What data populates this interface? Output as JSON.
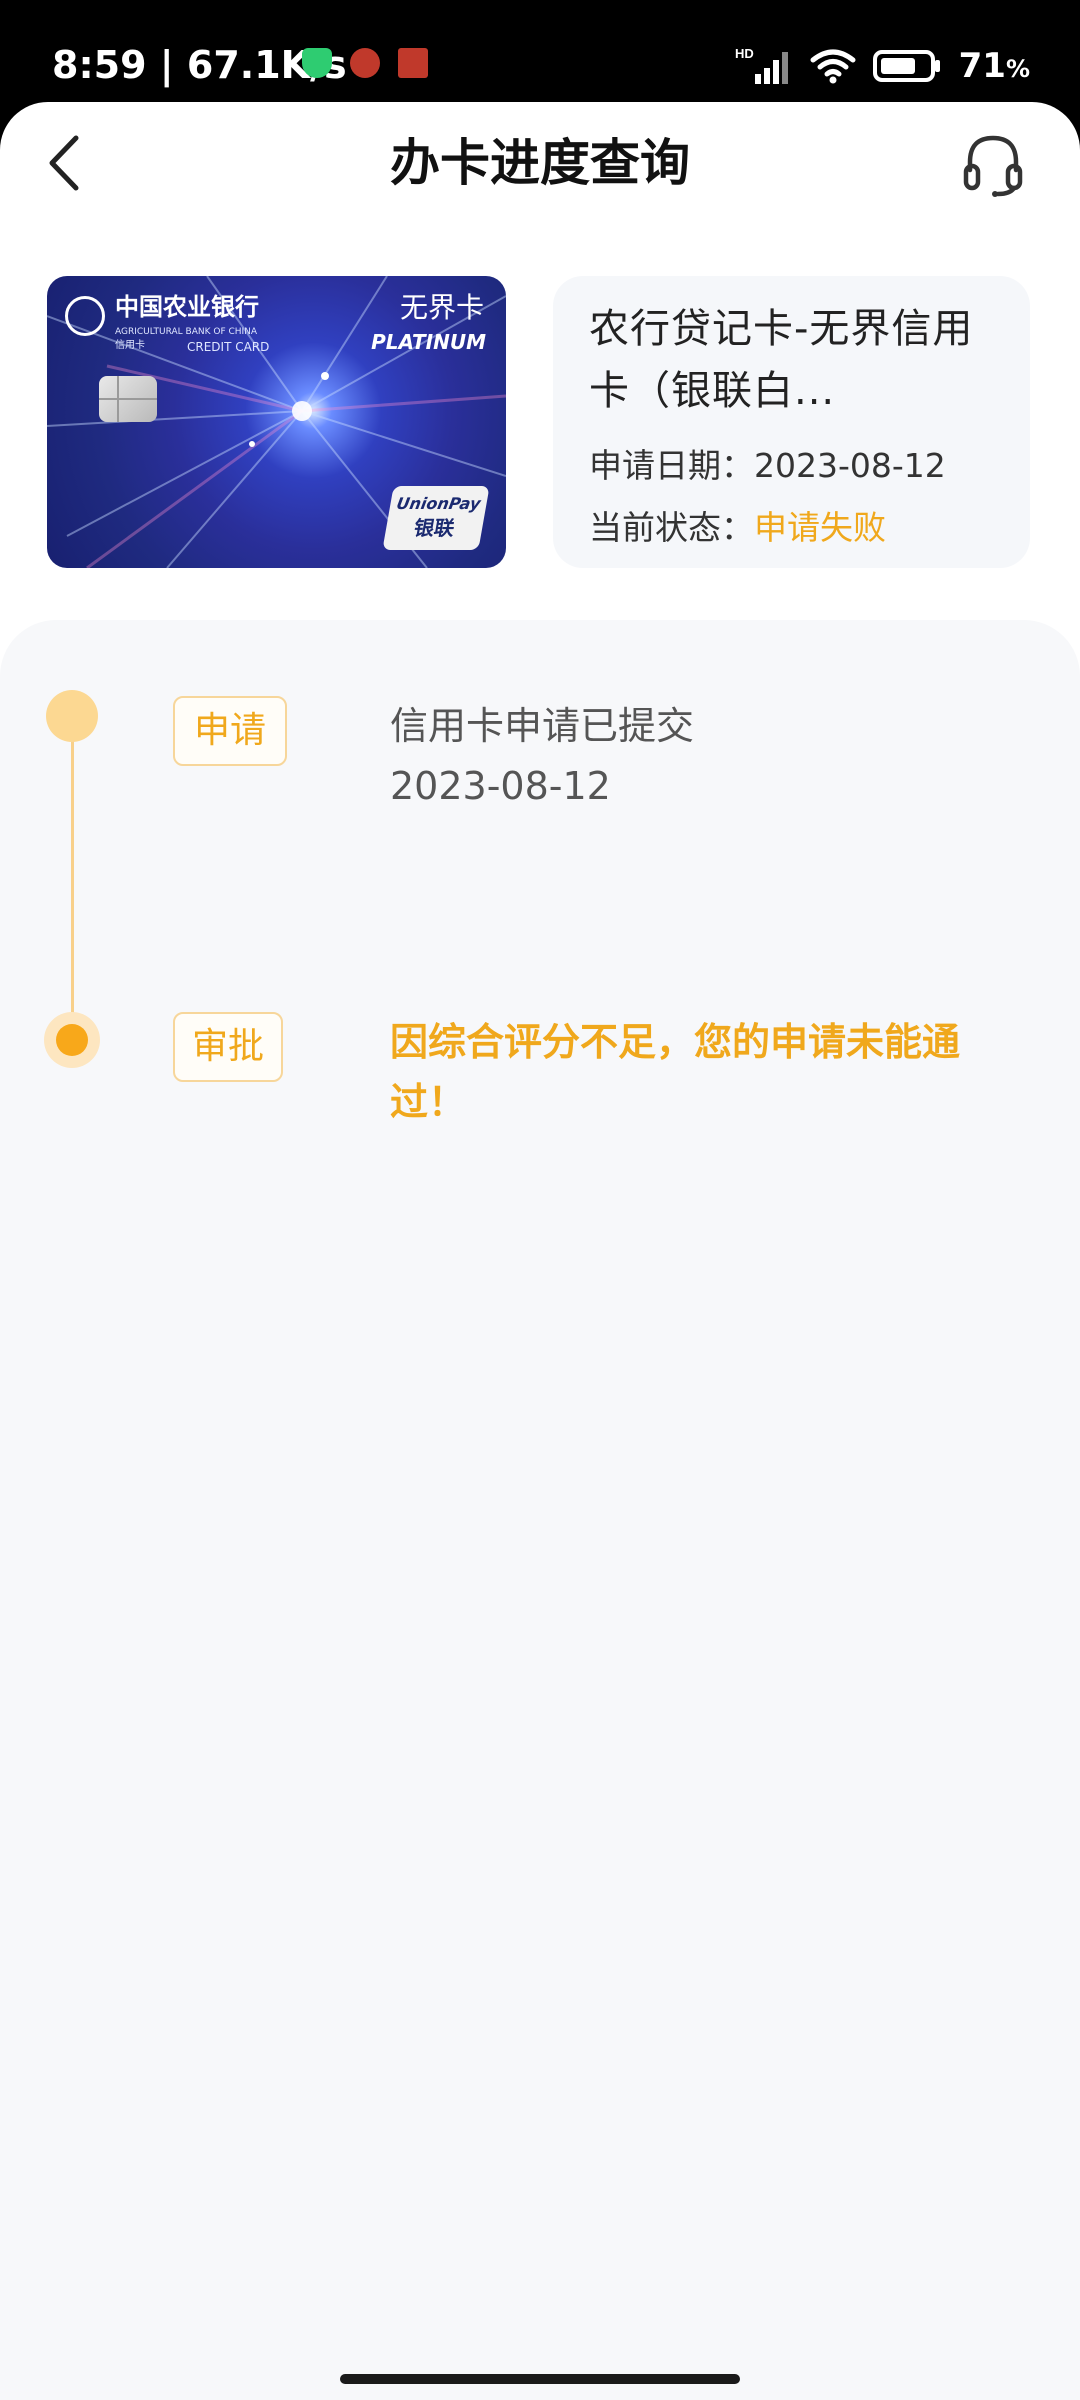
{
  "status_bar": {
    "time": "8:59",
    "speed": "67.1K/s",
    "network_type": "HD",
    "battery": "71",
    "battery_unit": "%",
    "app_icons": [
      "shield-icon",
      "metro-icon",
      "news-icon"
    ]
  },
  "nav": {
    "title": "办卡进度查询"
  },
  "card": {
    "image": {
      "bank_name": "中国农业银行",
      "bank_name_en": "AGRICULTURAL BANK OF CHINA",
      "sub_label": "信用卡",
      "type_label": "CREDIT CARD",
      "brand": "无界卡",
      "tier": "PLATINUM",
      "network_top": "UnionPay",
      "network_bottom": "银联"
    },
    "name": "农行贷记卡-无界信用卡（银联白...",
    "date_label": "申请日期：",
    "date_value": "2023-08-12",
    "status_label": "当前状态：",
    "status_value": "申请失败"
  },
  "steps": [
    {
      "tag": "申请",
      "desc": "信用卡申请已提交",
      "date": "2023-08-12"
    },
    {
      "tag": "审批",
      "desc": "因综合评分不足，您的申请未能通过！"
    }
  ],
  "colors": {
    "accent": "#f0a81c",
    "panel_bg": "#f7f8fa",
    "info_box_bg": "#f5f7fa"
  }
}
